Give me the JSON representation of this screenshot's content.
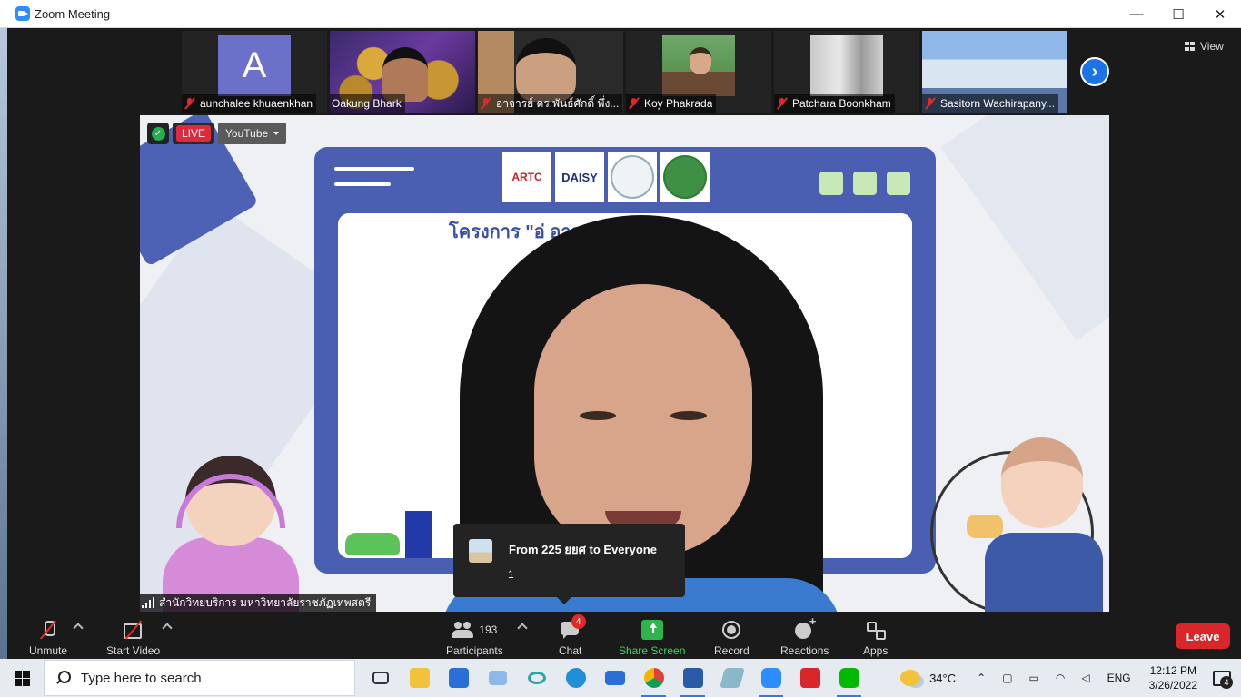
{
  "window": {
    "title": "Zoom Meeting",
    "minimize": "—",
    "maximize": "☐",
    "close": "✕"
  },
  "view_label": "View",
  "participants_strip": [
    {
      "name": "aunchalee khuaenkhan",
      "avatar_letter": "A",
      "muted": true
    },
    {
      "name": "Oakung Bhark",
      "muted": false
    },
    {
      "name": "อาจารย์ ดร.พันธ์ศักดิ์ พึ่ง...",
      "muted": true
    },
    {
      "name": "Koy Phakrada",
      "muted": true
    },
    {
      "name": "Patchara Boonkham",
      "muted": true
    },
    {
      "name": "Sasitorn Wachirapany...",
      "muted": true
    }
  ],
  "main_video": {
    "live_label": "LIVE",
    "stream_target": "YouTube",
    "speaker_name": "สำนักวิทยบริการ มหาวิทยาลัยราชภัฏเทพสตรี",
    "banner_text": "โครงการ \"อ่                         อาสา\"",
    "logo_daisy": "DAISY"
  },
  "chat_popup": {
    "from": "From 225 ยยศ to Everyone",
    "message": "1"
  },
  "toolbar": {
    "unmute": "Unmute",
    "start_video": "Start Video",
    "participants": "Participants",
    "participants_count": "193",
    "chat": "Chat",
    "chat_badge": "4",
    "share_screen": "Share Screen",
    "record": "Record",
    "reactions": "Reactions",
    "apps": "Apps",
    "leave": "Leave"
  },
  "taskbar": {
    "search_placeholder": "Type here to search",
    "temperature": "34°C",
    "language": "ENG",
    "time": "12:12 PM",
    "date": "3/26/2022",
    "notifications": "4"
  },
  "colors": {
    "accent_blue": "#2d8cff",
    "live_red": "#e02a3c",
    "share_green": "#2fb44e",
    "leave_red": "#d9262b"
  }
}
